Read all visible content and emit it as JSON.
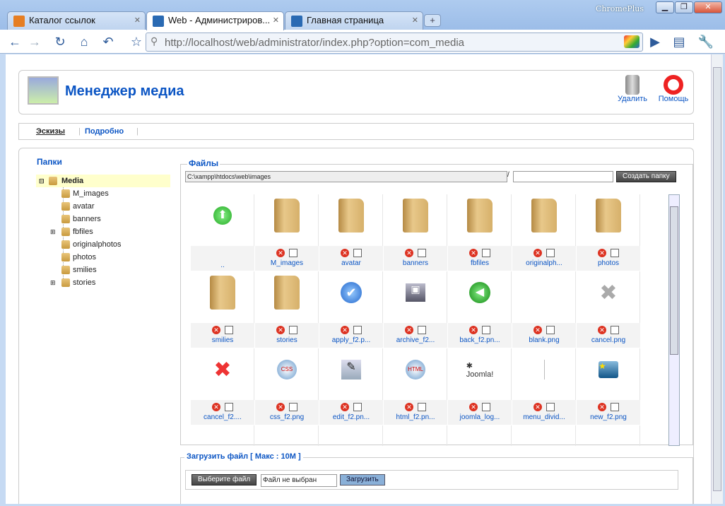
{
  "browser": {
    "brand": "ChromePlus",
    "tabs": [
      {
        "label": "Каталог ссылок",
        "icon": "xampp-icon",
        "color": "#e67e22"
      },
      {
        "label": "Web - Администриров...",
        "icon": "joomla-icon",
        "color": "#2a6ab3",
        "active": true
      },
      {
        "label": "Главная страница",
        "icon": "joomla-icon",
        "color": "#2a6ab3"
      }
    ],
    "url_host": "http://localhost",
    "url_path": "/web/administrator/index.php?option=com_media"
  },
  "header": {
    "title": "Менеджер медиа",
    "delete_label": "Удалить",
    "help_label": "Помощь"
  },
  "subnav": {
    "thumbs": "Эскизы",
    "details": "Подробно"
  },
  "folders": {
    "title": "Папки",
    "root": "Media",
    "items": [
      "M_images",
      "avatar",
      "banners",
      "fbfiles",
      "originalphotos",
      "photos",
      "smilies",
      "stories"
    ]
  },
  "files": {
    "title": "Файлы",
    "path": "C:\\xampp\\htdocs\\web\\images",
    "separator": "/",
    "create_folder": "Создать папку",
    "items": [
      {
        "name": "..",
        "kind": "up"
      },
      {
        "name": "M_images",
        "kind": "folder"
      },
      {
        "name": "avatar",
        "kind": "folder"
      },
      {
        "name": "banners",
        "kind": "folder"
      },
      {
        "name": "fbfiles",
        "kind": "folder"
      },
      {
        "name": "originalph...",
        "kind": "folder"
      },
      {
        "name": "photos",
        "kind": "folder"
      },
      {
        "name": "smilies",
        "kind": "folder"
      },
      {
        "name": "stories",
        "kind": "folder"
      },
      {
        "name": "apply_f2.p...",
        "kind": "apply"
      },
      {
        "name": "archive_f2...",
        "kind": "archive"
      },
      {
        "name": "back_f2.pn...",
        "kind": "back"
      },
      {
        "name": "blank.png",
        "kind": "blank"
      },
      {
        "name": "cancel.png",
        "kind": "cancel-gray"
      },
      {
        "name": "cancel_f2....",
        "kind": "cancel-red"
      },
      {
        "name": "css_f2.png",
        "kind": "css"
      },
      {
        "name": "edit_f2.pn...",
        "kind": "edit"
      },
      {
        "name": "html_f2.pn...",
        "kind": "html"
      },
      {
        "name": "joomla_log...",
        "kind": "joomla"
      },
      {
        "name": "menu_divid...",
        "kind": "divider"
      },
      {
        "name": "new_f2.png",
        "kind": "new"
      }
    ]
  },
  "upload": {
    "title": "Загрузить файл [ Макс : 10M ]",
    "choose": "Выберите файл",
    "nofile": "Файл не выбран",
    "submit": "Загрузить"
  }
}
